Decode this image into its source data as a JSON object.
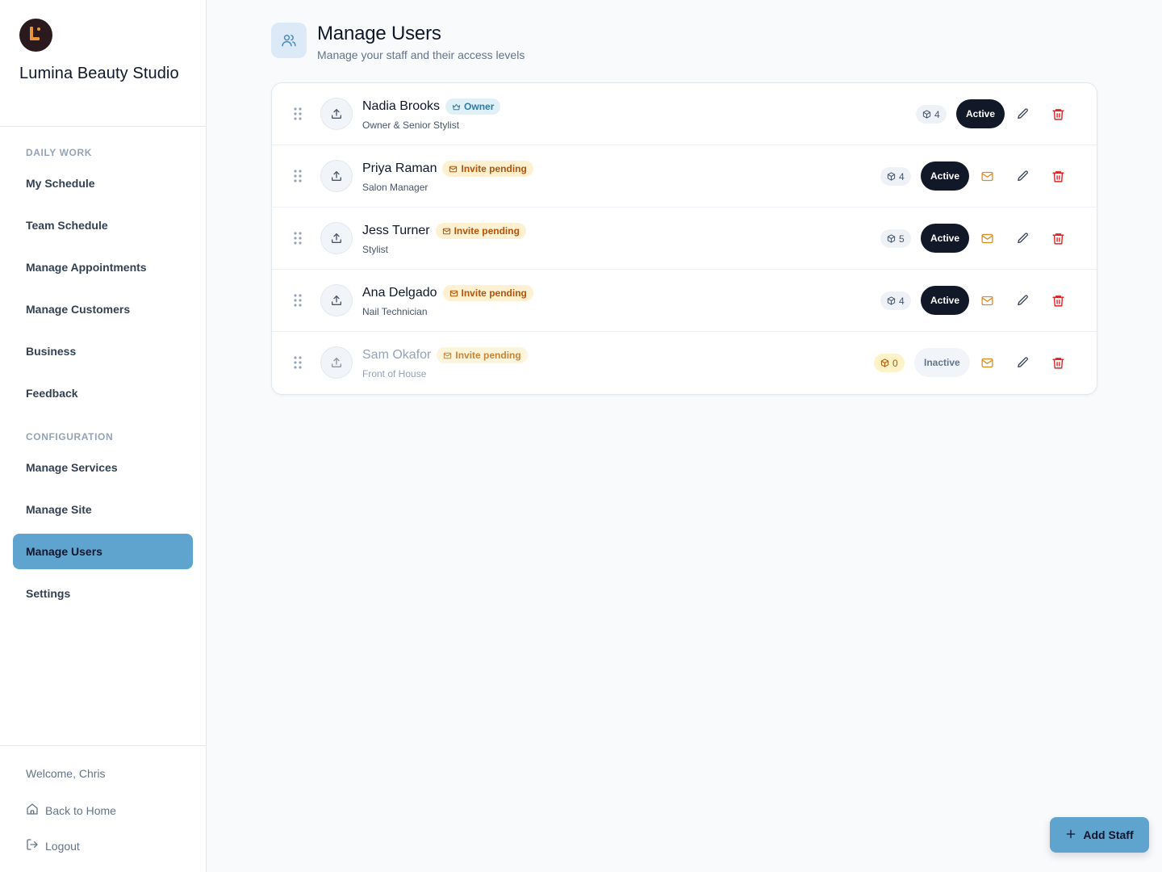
{
  "brand": {
    "name": "Lumina Beauty Studio",
    "icon": "logo-icon",
    "accent": "#e8953a"
  },
  "sidebar": {
    "sections": [
      {
        "title": "DAILY WORK"
      },
      {
        "title": "CONFIGURATION"
      }
    ],
    "items": [
      {
        "label": "My Schedule"
      },
      {
        "label": "Team Schedule"
      },
      {
        "label": "Manage Appointments"
      },
      {
        "label": "Manage Customers"
      },
      {
        "label": "Business"
      },
      {
        "label": "Feedback"
      },
      {
        "label": "Manage Services"
      },
      {
        "label": "Manage Site"
      },
      {
        "label": "Manage Users",
        "active": true
      },
      {
        "label": "Settings"
      }
    ],
    "active_color": "#5fa3cf"
  },
  "footer": {
    "welcome": "Welcome, Chris",
    "home": {
      "label": "Back to Home",
      "icon": "home-icon"
    },
    "logout": {
      "label": "Logout",
      "icon": "logout-icon"
    }
  },
  "header": {
    "title": "Manage Users",
    "subtitle": "Manage your staff and their access levels",
    "icon": "users-icon"
  },
  "users": [
    {
      "name": "Nadia Brooks",
      "badge": "Owner",
      "badge_type": "owner",
      "role": "Owner & Senior Stylist",
      "count": "4",
      "status": "Active"
    },
    {
      "name": "Priya Raman",
      "badge": "Invite pending",
      "badge_type": "pending",
      "role": "Salon Manager",
      "count": "4",
      "status": "Active"
    },
    {
      "name": "Jess Turner",
      "badge": "Invite pending",
      "badge_type": "pending",
      "role": "Stylist",
      "count": "5",
      "status": "Active"
    },
    {
      "name": "Ana Delgado",
      "badge": "Invite pending",
      "badge_type": "pending",
      "role": "Nail Technician",
      "count": "4",
      "status": "Active"
    },
    {
      "name": "Sam Okafor",
      "badge": "Invite pending",
      "badge_type": "pending",
      "role": "Front of House",
      "count": "0",
      "status": "Inactive"
    }
  ],
  "actions": {
    "resend_icon": "mail-icon",
    "edit_icon": "pencil-icon",
    "delete_icon": "trash-icon",
    "upload_icon": "upload-icon",
    "drag_icon": "drag-handle-icon",
    "count_icon": "box-icon"
  },
  "fab": {
    "label": "Add Staff",
    "icon": "plus-icon"
  },
  "colors": {
    "active_status": "#111827",
    "pending_badge": "#b45309",
    "owner_badge": "#2f7aa6",
    "delete": "#dc2626",
    "mail": "#e08a1e"
  }
}
